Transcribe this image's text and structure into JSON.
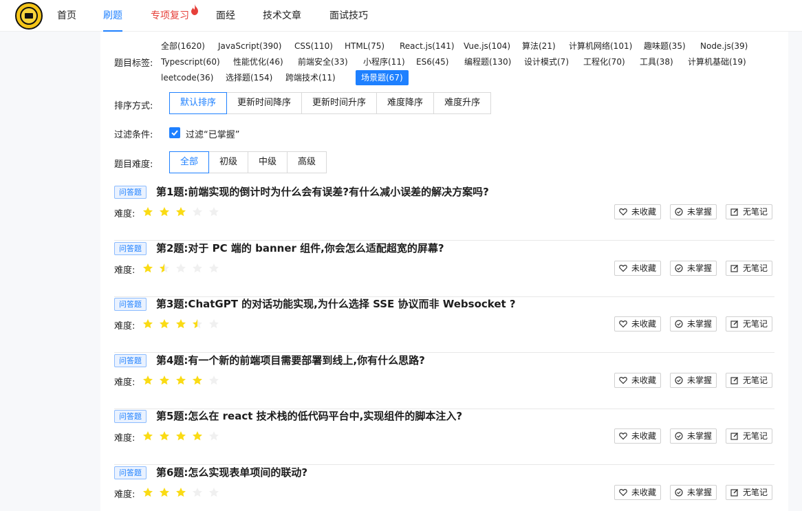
{
  "nav": {
    "items": [
      {
        "label": "首页",
        "state": ""
      },
      {
        "label": "刷题",
        "state": "active"
      },
      {
        "label": "专项复习",
        "state": "hot"
      },
      {
        "label": "面经",
        "state": ""
      },
      {
        "label": "技术文章",
        "state": ""
      },
      {
        "label": "面试技巧",
        "state": ""
      }
    ],
    "accent": "#1e80ff",
    "hot_color": "#e6403a"
  },
  "filters": {
    "tags_label": "题目标签:",
    "tags": [
      "全部(1620)",
      "JavaScript(390)",
      "CSS(110)",
      "HTML(75)",
      "React.js(141)",
      "Vue.js(104)",
      "算法(21)",
      "计算机网络(101)",
      "趣味题(35)",
      "Node.js(39)",
      "Typescript(60)",
      "性能优化(46)",
      "前端安全(33)",
      "小程序(11)",
      "ES6(45)",
      "编程题(130)",
      "设计模式(7)",
      "工程化(70)",
      "工具(38)",
      "计算机基础(19)",
      "leetcode(36)",
      "选择题(154)",
      "跨端技术(11)",
      "场景题(67)"
    ],
    "active_tag": "场景题(67)",
    "sort_label": "排序方式:",
    "sort_options": [
      "默认排序",
      "更新时间降序",
      "更新时间升序",
      "难度降序",
      "难度升序"
    ],
    "sort_selected": "默认排序",
    "filter_label": "过滤条件:",
    "filter_checkbox_label": "过滤“已掌握”",
    "filter_checked": true,
    "difficulty_label": "题目难度:",
    "difficulty_options": [
      "全部",
      "初级",
      "中级",
      "高级"
    ],
    "difficulty_selected": "全部"
  },
  "questions": [
    {
      "badge": "问答题",
      "title": "第1题:前端实现的倒计时为什么会有误差?有什么减小误差的解决方案吗?",
      "difficulty_label": "难度:",
      "rating": 3,
      "fav": "未收藏",
      "master": "未掌握",
      "note": "无笔记"
    },
    {
      "badge": "问答题",
      "title": "第2题:对于 PC 端的 banner 组件,你会怎么适配超宽的屏幕?",
      "difficulty_label": "难度:",
      "rating": 1.5,
      "fav": "未收藏",
      "master": "未掌握",
      "note": "无笔记"
    },
    {
      "badge": "问答题",
      "title": "第3题:ChatGPT 的对话功能实现,为什么选择 SSE 协议而非 Websocket ?",
      "difficulty_label": "难度:",
      "rating": 3.5,
      "fav": "未收藏",
      "master": "未掌握",
      "note": "无笔记"
    },
    {
      "badge": "问答题",
      "title": "第4题:有一个新的前端项目需要部署到线上,你有什么思路?",
      "difficulty_label": "难度:",
      "rating": 4,
      "fav": "未收藏",
      "master": "未掌握",
      "note": "无笔记"
    },
    {
      "badge": "问答题",
      "title": "第5题:怎么在 react 技术栈的低代码平台中,实现组件的脚本注入?",
      "difficulty_label": "难度:",
      "rating": 4,
      "fav": "未收藏",
      "master": "未掌握",
      "note": "无笔记"
    },
    {
      "badge": "问答题",
      "title": "第6题:怎么实现表单项间的联动?",
      "difficulty_label": "难度:",
      "rating": 3,
      "fav": "未收藏",
      "master": "未掌握",
      "note": "无笔记"
    }
  ],
  "star_color": "#fadb14",
  "star_empty_color": "#f0f0f0"
}
